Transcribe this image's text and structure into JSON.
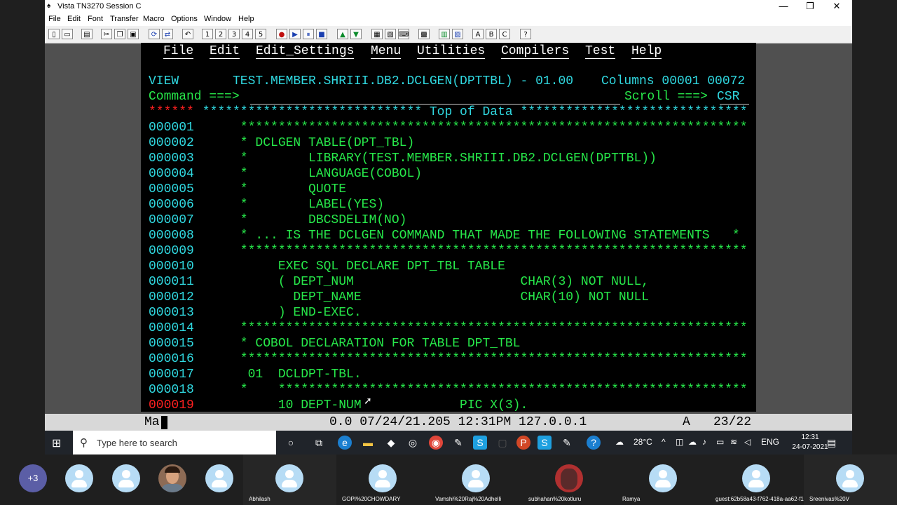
{
  "window": {
    "title": "Vista TN3270 Session C",
    "controls": {
      "minimize": "—",
      "restore": "❐",
      "close": "✕"
    }
  },
  "menubar": [
    "File",
    "Edit",
    "Font",
    "Transfer",
    "Macro",
    "Options",
    "Window",
    "Help"
  ],
  "toolbar": {
    "icons": [
      "new-icon",
      "open-icon",
      "print-icon",
      "cut-icon",
      "copy-icon",
      "paste-icon",
      "reconnect-icon",
      "disconnect-icon",
      "undo-icon",
      "macro-1-icon",
      "macro-2-icon",
      "macro-3-icon",
      "macro-4-icon",
      "macro-5-icon",
      "record-icon",
      "play-icon",
      "pause-icon",
      "stop-icon",
      "upload-icon",
      "download-icon",
      "settings-1-icon",
      "settings-2-icon",
      "keyboard-icon",
      "colors-icon",
      "font-icon",
      "a-icon",
      "b-icon",
      "c-icon",
      "help-icon"
    ],
    "labels": {
      "a": "A",
      "b": "B",
      "c": "C",
      "help": "?",
      "m1": "1",
      "m2": "2",
      "m3": "3",
      "m4": "4",
      "m5": "5"
    }
  },
  "ispf": {
    "menu": [
      "File",
      "Edit",
      "Edit_Settings",
      "Menu",
      "Utilities",
      "Compilers",
      "Test",
      "Help"
    ],
    "mode": "VIEW",
    "dataset": "TEST.MEMBER.SHRIII.DB2.DCLGEN(DPTTBL) - 01.00",
    "columns": "Columns 00001 00072",
    "command_prompt": "Command ===>",
    "command_value": "",
    "scroll_prompt": "Scroll ===>",
    "scroll_value": "CSR",
    "top_prefix": "******",
    "top_banner": " ***************************** Top of Data ******************************",
    "lines": [
      {
        "num": "000001",
        "text": "      *******************************************************************"
      },
      {
        "num": "000002",
        "text": "      * DCLGEN TABLE(DPT_TBL)                                             *"
      },
      {
        "num": "000003",
        "text": "      *        LIBRARY(TEST.MEMBER.SHRIII.DB2.DCLGEN(DPTTBL))             *"
      },
      {
        "num": "000004",
        "text": "      *        LANGUAGE(COBOL)                                            *"
      },
      {
        "num": "000005",
        "text": "      *        QUOTE                                                      *"
      },
      {
        "num": "000006",
        "text": "      *        LABEL(YES)                                                 *"
      },
      {
        "num": "000007",
        "text": "      *        DBCSDELIM(NO)                                              *"
      },
      {
        "num": "000008",
        "text": "      * ... IS THE DCLGEN COMMAND THAT MADE THE FOLLOWING STATEMENTS   *"
      },
      {
        "num": "000009",
        "text": "      *******************************************************************"
      },
      {
        "num": "000010",
        "text": "           EXEC SQL DECLARE DPT_TBL TABLE"
      },
      {
        "num": "000011",
        "text": "           ( DEPT_NUM                      CHAR(3) NOT NULL,"
      },
      {
        "num": "000012",
        "text": "             DEPT_NAME                     CHAR(10) NOT NULL"
      },
      {
        "num": "000013",
        "text": "           ) END-EXEC."
      },
      {
        "num": "000014",
        "text": "      *******************************************************************"
      },
      {
        "num": "000015",
        "text": "      * COBOL DECLARATION FOR TABLE DPT_TBL                               *"
      },
      {
        "num": "000016",
        "text": "      *******************************************************************"
      },
      {
        "num": "000017",
        "text": "       01  DCLDPT-TBL."
      },
      {
        "num": "000018",
        "text": "      *    **************************************************************"
      },
      {
        "num": "000019",
        "text": "           10 DEPT-NUM             PIC X(3)."
      }
    ]
  },
  "statusbar": {
    "input": "Ma",
    "center": "0.0 07/24/21.205 12:31PM 127.0.0.1",
    "mode": "A",
    "cursor": "23/22"
  },
  "taskbar": {
    "search_placeholder": "Type here to search",
    "weather": "28°C",
    "language": "ENG",
    "time": "12:31",
    "date": "24-07-2021",
    "app_icons": [
      "cortana-icon",
      "task-view-icon",
      "edge-icon",
      "file-explorer-icon",
      "dropbox-icon",
      "app-icon",
      "chrome-icon",
      "tool-icon",
      "skype-icon",
      "blank-app-icon",
      "powerpoint-icon",
      "skype-2-icon",
      "tool-2-icon",
      "help-icon"
    ]
  },
  "meeting": {
    "overflow": "+3",
    "participants": [
      {
        "name": ""
      },
      {
        "name": ""
      },
      {
        "name": "",
        "photo": true
      },
      {
        "name": ""
      },
      {
        "name": "Abhilash"
      },
      {
        "name": "GOPI%20CHOWDARY"
      },
      {
        "name": "Vamshi%20Raj%20Adhelli"
      },
      {
        "name": "subhahan%20kotluru",
        "photo": true
      },
      {
        "name": "Ramya"
      },
      {
        "name": "guest:62b58a43-f762-418a-aa62-f1..."
      },
      {
        "name": "Sreenivas%20V"
      }
    ]
  }
}
